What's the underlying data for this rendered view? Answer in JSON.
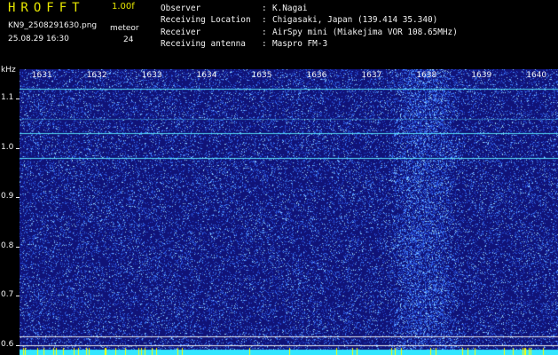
{
  "header": {
    "title": "HROFFT",
    "version": "1.00f",
    "filename": "KN9_2508291630.png",
    "datetime": "25.08.29 16:30",
    "meteor_label": "meteor",
    "meteor_count": "24"
  },
  "info": [
    {
      "key": "Observer",
      "value": "K.Nagai"
    },
    {
      "key": "Receiving Location",
      "value": "Chigasaki, Japan (139.414 35.340)"
    },
    {
      "key": "Receiver",
      "value": "AirSpy mini (Miakejima VOR 108.65MHz)"
    },
    {
      "key": "Receiving antenna",
      "value": "Maspro FM-3"
    }
  ],
  "spectrogram": {
    "freq_unit": "kHz",
    "freq_axis_label_values": [
      "1.1",
      "1.0",
      "0.9",
      "0.8",
      "0.7",
      "0.6"
    ],
    "freq_range_khz": [
      0.58,
      1.16
    ],
    "time_labels": [
      "1631",
      "1632",
      "1633",
      "1634",
      "1635",
      "1636",
      "1637",
      "1638",
      "1639",
      "1640"
    ],
    "time_range_minutes": [
      1630.6,
      1640.4
    ],
    "horizontal_lines_khz": [
      1.12,
      1.03,
      0.98
    ],
    "faint_line_khz": 1.06,
    "bottom_lines_khz": [
      0.617,
      0.6
    ],
    "bright_band_minutes": [
      1637.3,
      1638.6
    ],
    "colors": {
      "background": "#10137a",
      "noise": "#3c6bff",
      "bright": "#86d8ff",
      "line": "#5df0ff",
      "title": "#e6e600"
    }
  }
}
